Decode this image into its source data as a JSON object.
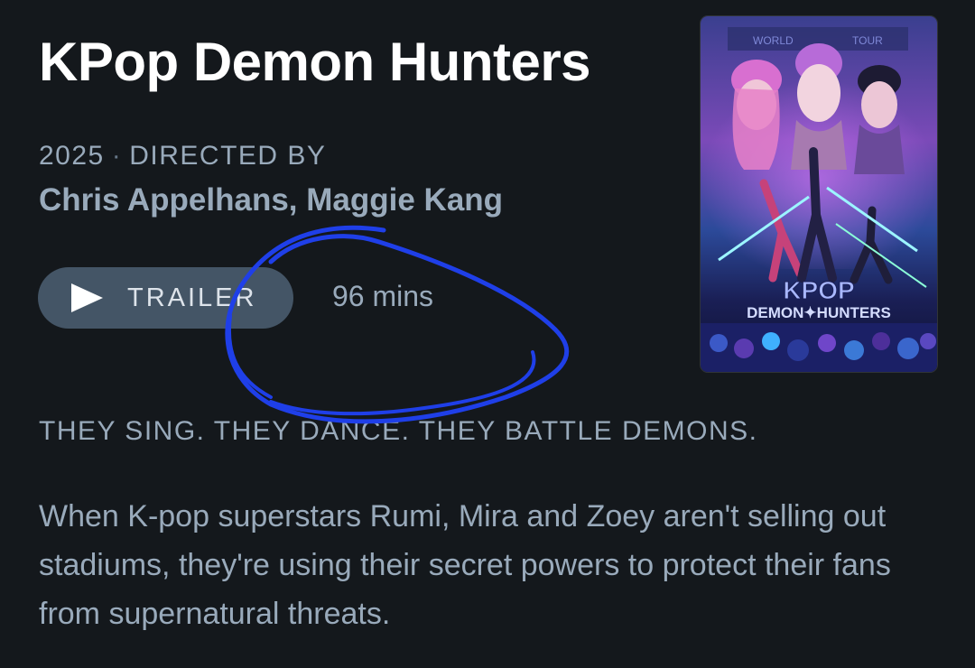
{
  "film": {
    "title": "KPop Demon Hunters",
    "year": "2025",
    "separator": "·",
    "directed_by_label": "DIRECTED BY",
    "directors": "Chris Appelhans, Maggie Kang",
    "runtime": "96 mins",
    "tagline": "THEY SING. THEY DANCE. THEY BATTLE DEMONS.",
    "synopsis": "When K-pop superstars Rumi, Mira and Zoey aren't selling out stadiums, they're using their secret powers to protect their fans from supernatural threats."
  },
  "actions": {
    "trailer_label": "TRAILER",
    "trailer_icon": "play-icon"
  },
  "poster": {
    "logo_line1": "KPOP",
    "logo_line2": "DEMON✦HUNTERS",
    "banner_left": "WORLD",
    "banner_right": "TOUR"
  },
  "colors": {
    "background": "#14181c",
    "title": "#ffffff",
    "muted_text": "#99aabb",
    "button_bg": "#445566",
    "annotation_stroke": "#1f3fe8"
  }
}
